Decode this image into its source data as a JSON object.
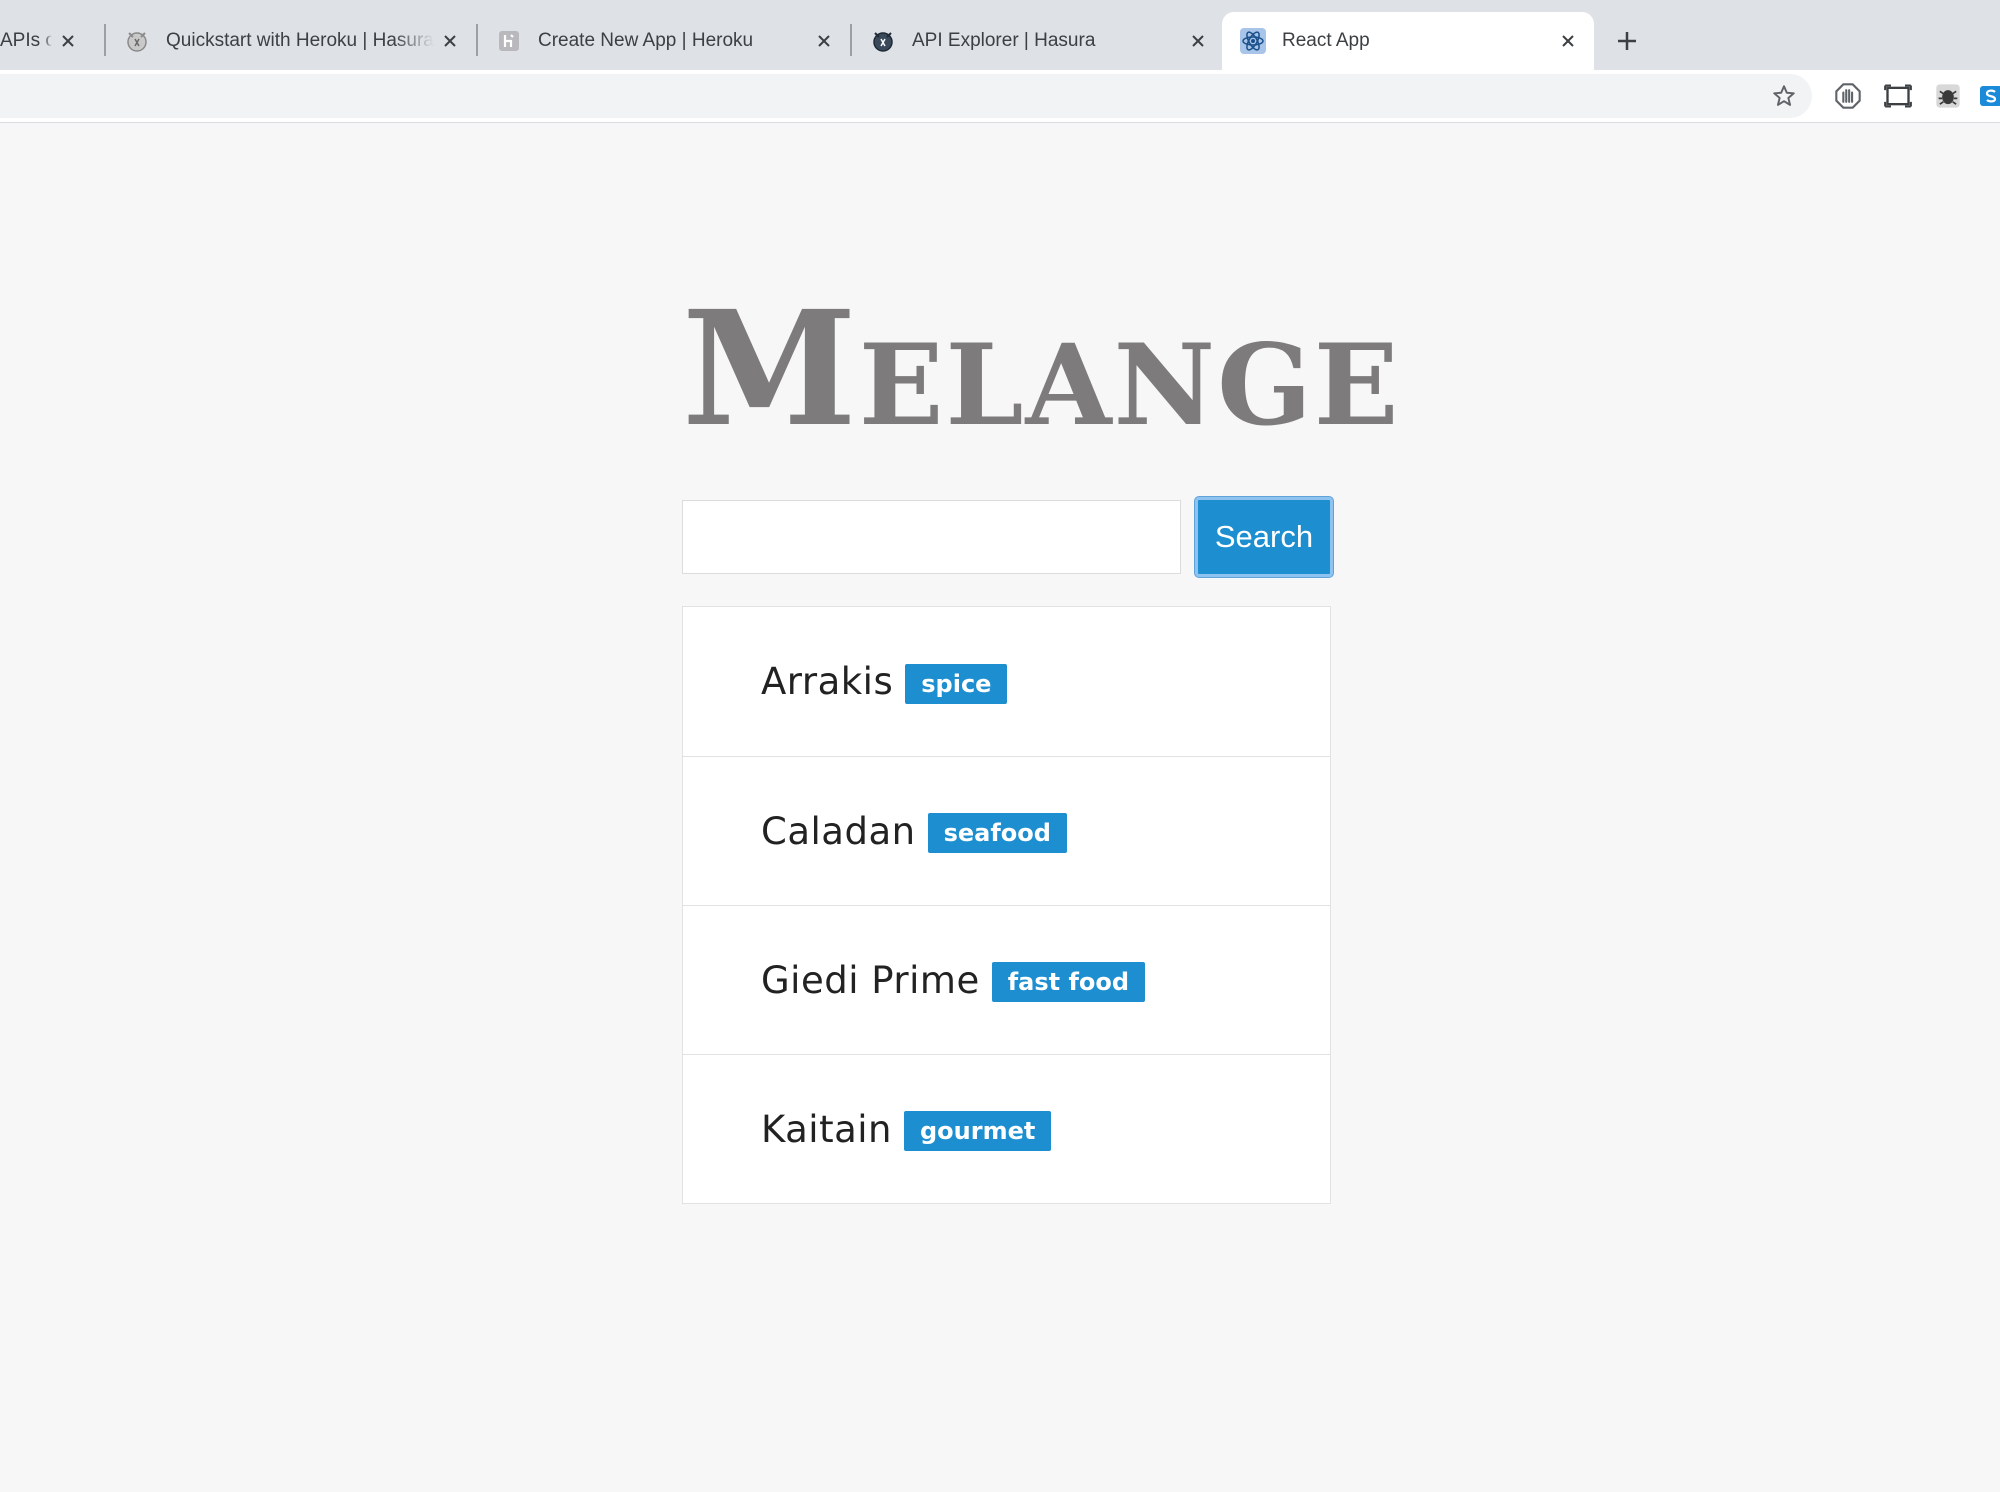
{
  "browser": {
    "tabs": [
      {
        "title": "APIs on",
        "icon": "partial-tab-icon",
        "active": false
      },
      {
        "title": "Quickstart with Heroku | Hasura",
        "icon": "hasura-icon",
        "active": false
      },
      {
        "title": "Create New App | Heroku",
        "icon": "heroku-icon",
        "active": false
      },
      {
        "title": "API Explorer | Hasura",
        "icon": "hasura-icon",
        "active": false
      },
      {
        "title": "React App",
        "icon": "react-icon",
        "active": true
      }
    ],
    "toolbar_icons": [
      "bookmark-star-icon",
      "shield-extension-icon",
      "screenshot-extension-icon",
      "bug-extension-icon",
      "s-extension-icon"
    ]
  },
  "page": {
    "logo": "Melange",
    "search": {
      "value": "",
      "placeholder": "",
      "button_label": "Search"
    },
    "results": [
      {
        "name": "Arrakis",
        "tag": "spice"
      },
      {
        "name": "Caladan",
        "tag": "seafood"
      },
      {
        "name": "Giedi Prime",
        "tag": "fast food"
      },
      {
        "name": "Kaitain",
        "tag": "gourmet"
      }
    ]
  },
  "colors": {
    "accent": "#1d8fd0",
    "logo": "#7d7b7b",
    "page_background": "#f7f7f7",
    "tab_strip": "#dee1e6"
  }
}
